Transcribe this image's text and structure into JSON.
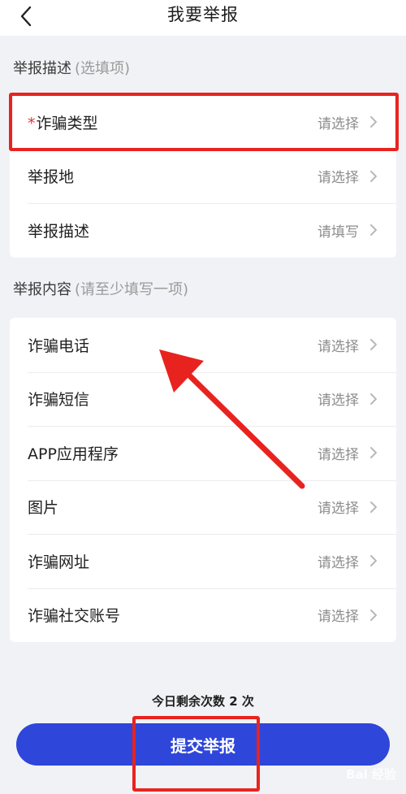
{
  "header": {
    "title": "我要举报"
  },
  "section1": {
    "title": "举报描述",
    "hint": "(选填项)",
    "rows": [
      {
        "required_mark": "*",
        "label": "诈骗类型",
        "value": "请选择"
      },
      {
        "label": "举报地",
        "value": "请选择"
      },
      {
        "label": "举报描述",
        "value": "请填写"
      }
    ]
  },
  "section2": {
    "title": "举报内容",
    "hint": "(请至少填写一项)",
    "rows": [
      {
        "label": "诈骗电话",
        "value": "请选择"
      },
      {
        "label": "诈骗短信",
        "value": "请选择"
      },
      {
        "label": "APP应用程序",
        "value": "请选择"
      },
      {
        "label": "图片",
        "value": "请选择"
      },
      {
        "label": "诈骗网址",
        "value": "请选择"
      },
      {
        "label": "诈骗社交账号",
        "value": "请选择"
      }
    ]
  },
  "footer": {
    "remaining_text": "今日剩余次数 2 次",
    "submit_label": "提交举报"
  },
  "watermark": "Bai 经验",
  "colors": {
    "accent": "#2e46d9",
    "annotation": "#e8231f",
    "required": "#e0382f"
  }
}
